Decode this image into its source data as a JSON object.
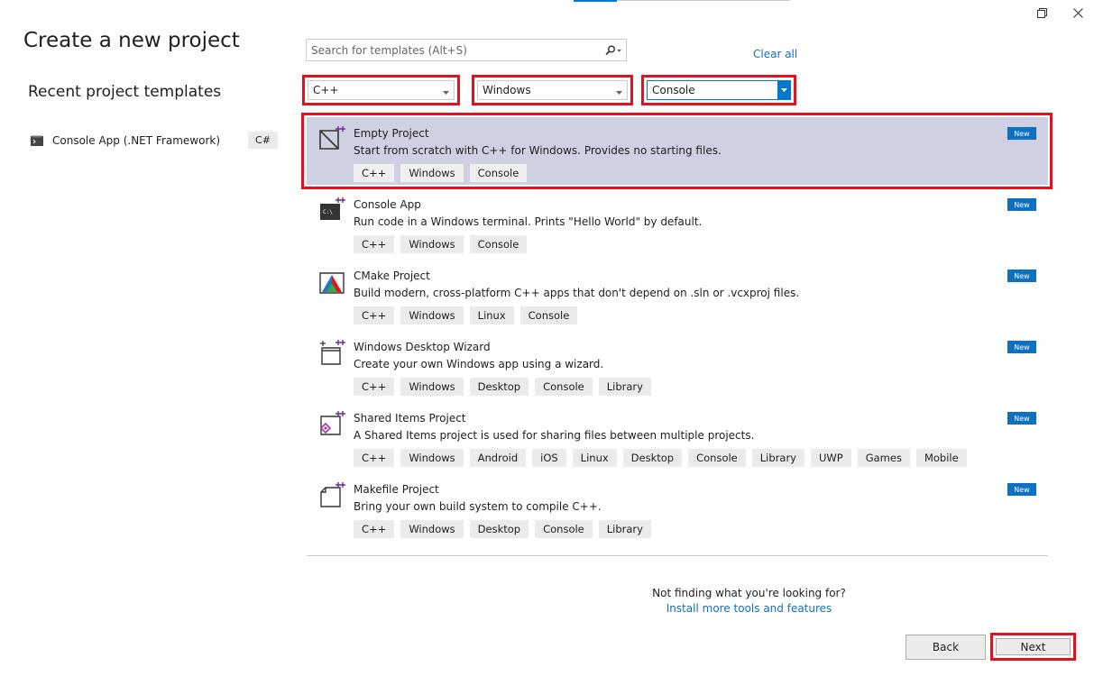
{
  "window": {
    "restore_icon": "restore-icon",
    "close_icon": "close-icon"
  },
  "left": {
    "title": "Create a new project",
    "recent_heading": "Recent project templates",
    "recent_items": [
      {
        "label": "Console App (.NET Framework)",
        "lang": "C#",
        "icon": "console-app-icon"
      }
    ]
  },
  "search": {
    "placeholder": "Search for templates (Alt+S)",
    "icon": "search-icon"
  },
  "clear_all": "Clear all",
  "filters": {
    "language": "C++",
    "platform": "Windows",
    "project_type": "Console"
  },
  "templates": [
    {
      "name": "Empty Project",
      "description": "Start from scratch with C++ for Windows. Provides no starting files.",
      "tags": [
        "C++",
        "Windows",
        "Console"
      ],
      "badge": "New",
      "icon": "empty-project-icon"
    },
    {
      "name": "Console App",
      "description": "Run code in a Windows terminal. Prints \"Hello World\" by default.",
      "tags": [
        "C++",
        "Windows",
        "Console"
      ],
      "badge": "New",
      "icon": "console-app-icon"
    },
    {
      "name": "CMake Project",
      "description": "Build modern, cross-platform C++ apps that don't depend on .sln or .vcxproj files.",
      "tags": [
        "C++",
        "Windows",
        "Linux",
        "Console"
      ],
      "badge": "New",
      "icon": "cmake-icon"
    },
    {
      "name": "Windows Desktop Wizard",
      "description": "Create your own Windows app using a wizard.",
      "tags": [
        "C++",
        "Windows",
        "Desktop",
        "Console",
        "Library"
      ],
      "badge": "New",
      "icon": "wizard-icon"
    },
    {
      "name": "Shared Items Project",
      "description": "A Shared Items project is used for sharing files between multiple projects.",
      "tags": [
        "C++",
        "Windows",
        "Android",
        "iOS",
        "Linux",
        "Desktop",
        "Console",
        "Library",
        "UWP",
        "Games",
        "Mobile"
      ],
      "badge": "New",
      "icon": "shared-items-icon"
    },
    {
      "name": "Makefile Project",
      "description": "Bring your own build system to compile C++.",
      "tags": [
        "C++",
        "Windows",
        "Desktop",
        "Console",
        "Library"
      ],
      "badge": "New",
      "icon": "makefile-icon"
    }
  ],
  "not_finding": {
    "question": "Not finding what you're looking for?",
    "link": "Install more tools and features"
  },
  "buttons": {
    "back": "Back",
    "next": "Next"
  }
}
